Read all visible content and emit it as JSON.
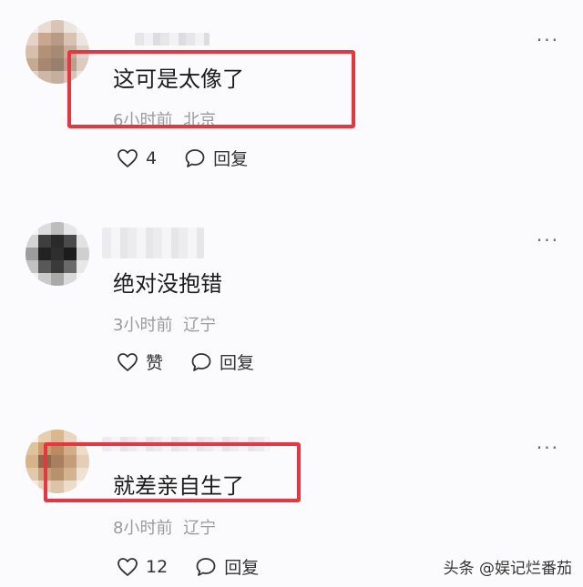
{
  "comments": [
    {
      "text": "这可是太像了",
      "time": "6小时前",
      "location": "北京",
      "like_label": "4",
      "reply_label": "回复",
      "more_label": "···"
    },
    {
      "text": "绝对没抱错",
      "time": "3小时前",
      "location": "辽宁",
      "like_label": "赞",
      "reply_label": "回复",
      "more_label": "···"
    },
    {
      "text": "就差亲自生了",
      "time": "8小时前",
      "location": "辽宁",
      "like_label": "12",
      "reply_label": "回复",
      "more_label": "···"
    }
  ],
  "watermark": "头条 @娱记烂番茄",
  "colors": {
    "highlight": "#e8353f",
    "meta_text": "#9a9a9f",
    "background": "#fbfbfd"
  },
  "icons": [
    "heart-outline-icon",
    "speech-bubble-icon",
    "more-dots-icon"
  ]
}
